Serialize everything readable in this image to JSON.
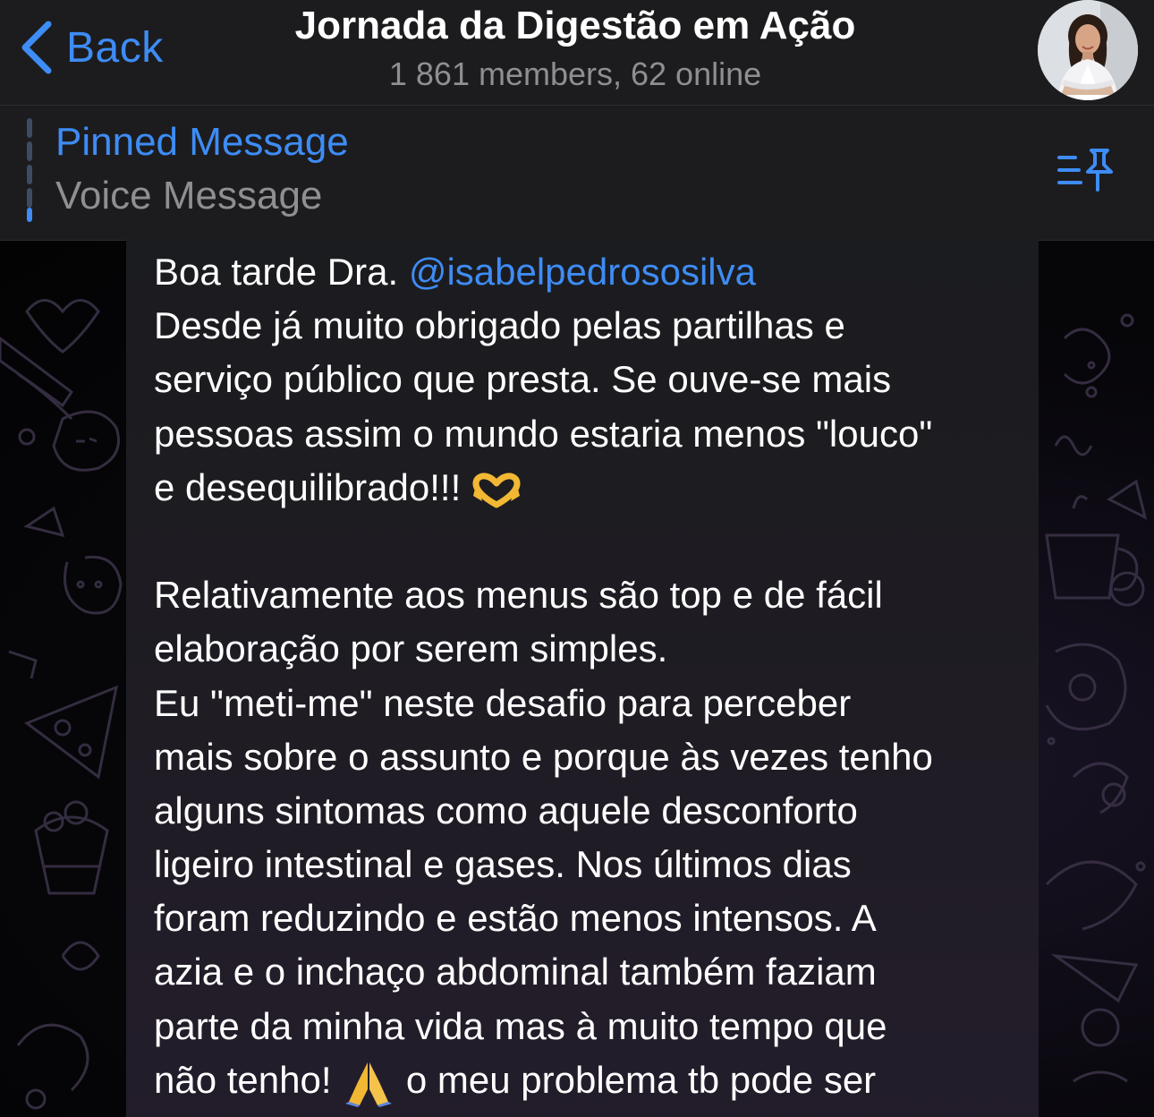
{
  "nav": {
    "back_label": "Back",
    "title": "Jornada da Digestão em Ação",
    "subtitle": "1 861 members, 62 online",
    "accent_color": "#3e8cf5"
  },
  "pinned": {
    "title": "Pinned Message",
    "subtitle": "Voice Message",
    "icon": "pin-list-icon"
  },
  "message": {
    "greeting": "Boa tarde Dra. ",
    "mention": "@isabelpedrososilva",
    "lines": [
      "Desde já muito obrigado pelas partilhas e",
      "serviço público que presta. Se ouve-se mais",
      "pessoas assim o mundo estaria menos \"louco\"",
      "e desequilibrado!!! ",
      "",
      "Relativamente aos menus são top e de fácil",
      "elaboração por serem simples.",
      "Eu \"meti-me\" neste desafio para perceber",
      "mais sobre o assunto e porque às vezes tenho",
      "alguns sintomas como aquele desconforto",
      "ligeiro intestinal e gases. Nos últimos dias",
      "foram reduzindo e estão menos intensos. A",
      "azia e o inchaço abdominal também faziam",
      "parte da minha vida mas à muito tempo que",
      "não tenho! ",
      " o meu problema tb pode ser"
    ],
    "emojis": [
      "heart-hands-emoji",
      "folded-hands-emoji"
    ]
  }
}
